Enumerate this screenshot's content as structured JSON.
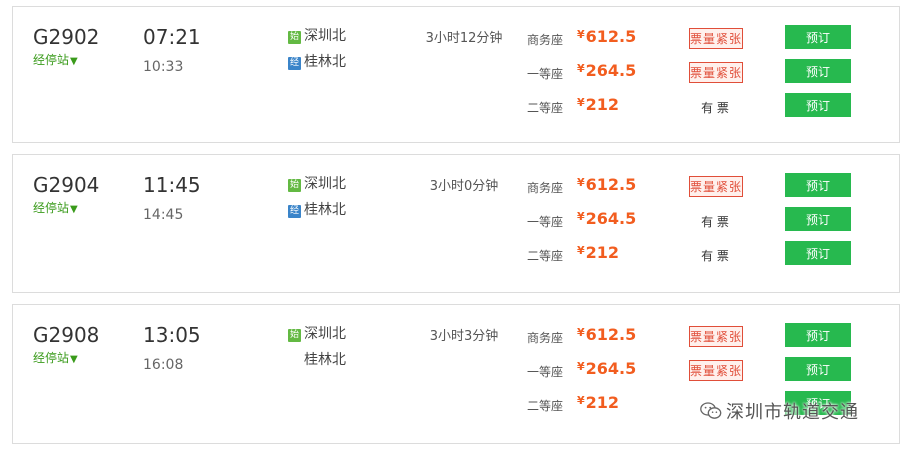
{
  "trains": [
    {
      "train_no": "G2902",
      "stops_label": "经停站",
      "stops_arrow": "▼",
      "depart_time": "07:21",
      "arrive_time": "10:33",
      "from_badge": "始",
      "from_station": "深圳北",
      "to_badge": "经",
      "to_station": "桂林北",
      "duration": "3小时12分钟",
      "seats": [
        {
          "class": "商务座",
          "currency": "¥",
          "price": "612.5",
          "status": "票量紧张",
          "status_type": "tight",
          "book_label": "预订"
        },
        {
          "class": "一等座",
          "currency": "¥",
          "price": "264.5",
          "status": "票量紧张",
          "status_type": "tight",
          "book_label": "预订"
        },
        {
          "class": "二等座",
          "currency": "¥",
          "price": "212",
          "status": "有 票",
          "status_type": "avail",
          "book_label": "预订"
        }
      ]
    },
    {
      "train_no": "G2904",
      "stops_label": "经停站",
      "stops_arrow": "▼",
      "depart_time": "11:45",
      "arrive_time": "14:45",
      "from_badge": "始",
      "from_station": "深圳北",
      "to_badge": "经",
      "to_station": "桂林北",
      "duration": "3小时0分钟",
      "seats": [
        {
          "class": "商务座",
          "currency": "¥",
          "price": "612.5",
          "status": "票量紧张",
          "status_type": "tight",
          "book_label": "预订"
        },
        {
          "class": "一等座",
          "currency": "¥",
          "price": "264.5",
          "status": "有 票",
          "status_type": "avail",
          "book_label": "预订"
        },
        {
          "class": "二等座",
          "currency": "¥",
          "price": "212",
          "status": "有 票",
          "status_type": "avail",
          "book_label": "预订"
        }
      ]
    },
    {
      "train_no": "G2908",
      "stops_label": "经停站",
      "stops_arrow": "▼",
      "depart_time": "13:05",
      "arrive_time": "16:08",
      "from_badge": "始",
      "from_station": "深圳北",
      "to_badge": "",
      "to_station": "桂林北",
      "duration": "3小时3分钟",
      "seats": [
        {
          "class": "商务座",
          "currency": "¥",
          "price": "612.5",
          "status": "票量紧张",
          "status_type": "tight",
          "book_label": "预订"
        },
        {
          "class": "一等座",
          "currency": "¥",
          "price": "264.5",
          "status": "票量紧张",
          "status_type": "tight",
          "book_label": "预订"
        },
        {
          "class": "二等座",
          "currency": "¥",
          "price": "212",
          "status": "",
          "status_type": "none",
          "book_label": "预订"
        }
      ]
    }
  ],
  "watermark": {
    "text": "深圳市轨道交通",
    "icon": "wechat-icon"
  },
  "colors": {
    "price": "#f25d1f",
    "book_button": "#27b94f",
    "stops_link": "#3a9b1b",
    "tight_status": "#e04e39"
  }
}
